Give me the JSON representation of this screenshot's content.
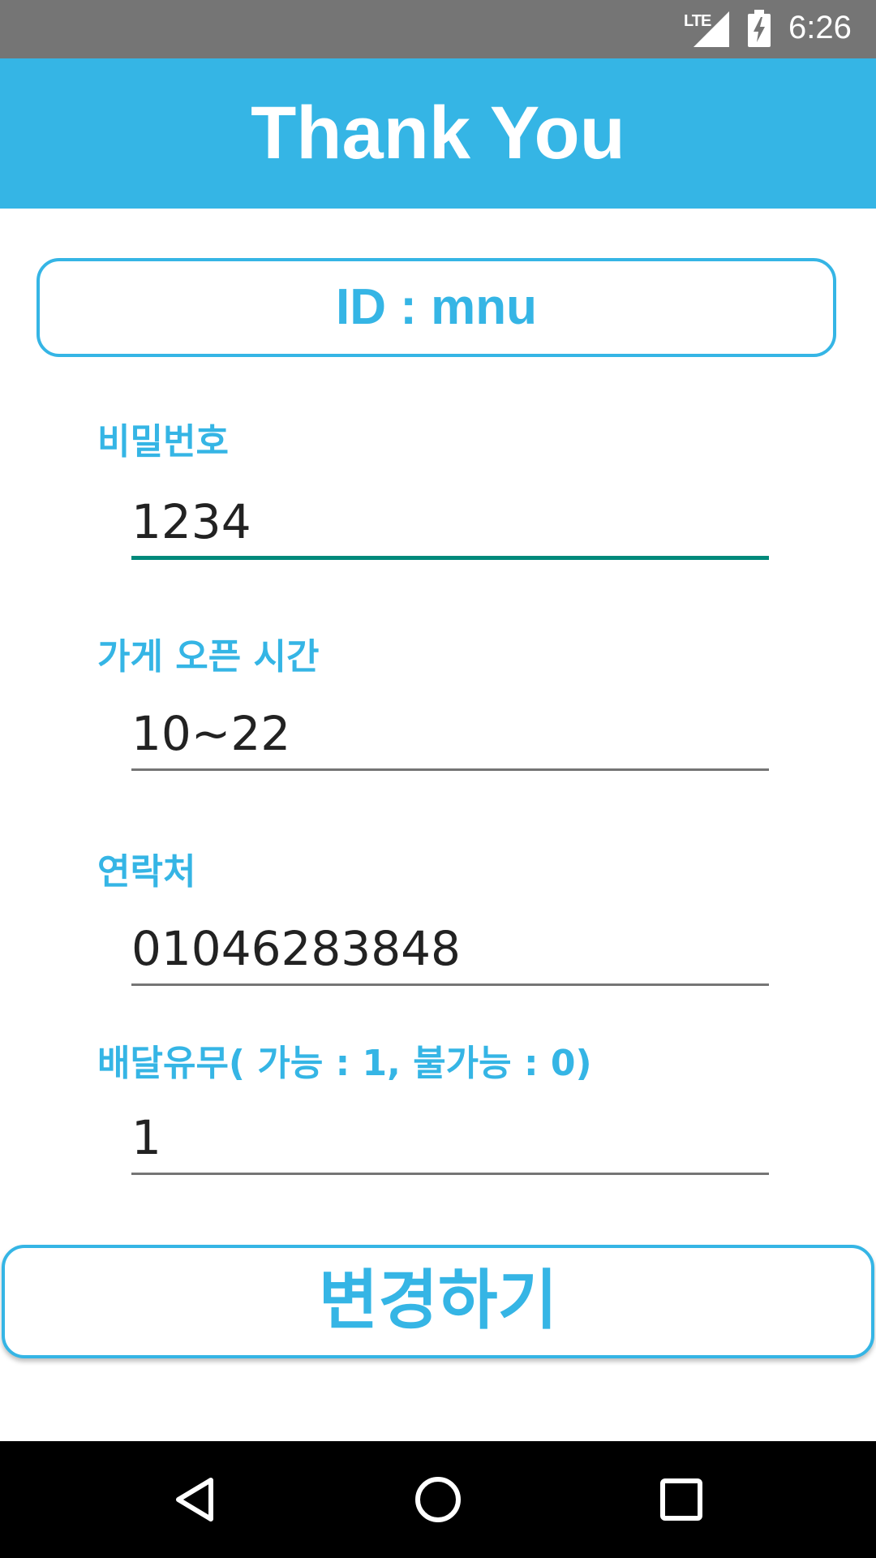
{
  "theme": {
    "accent": "#35b5e5",
    "focus_underline": "#00897b"
  },
  "status_bar": {
    "network": "LTE",
    "time": "6:26",
    "icons": [
      "lte-signal-icon",
      "battery-charging-icon"
    ]
  },
  "app_bar": {
    "title": "Thank You"
  },
  "id_box": {
    "text": "ID : mnu"
  },
  "form": {
    "password": {
      "label": "비밀번호",
      "value": "1234"
    },
    "open_hours": {
      "label": "가게 오픈 시간",
      "value": "10~22"
    },
    "contact": {
      "label": "연락처",
      "value": "01046283848"
    },
    "delivery": {
      "label": "배달유무( 가능 : 1, 불가능 : 0)",
      "value": "1"
    }
  },
  "actions": {
    "change_label": "변경하기"
  },
  "nav_bar": {
    "icons": [
      "back-icon",
      "home-icon",
      "recents-icon"
    ]
  }
}
